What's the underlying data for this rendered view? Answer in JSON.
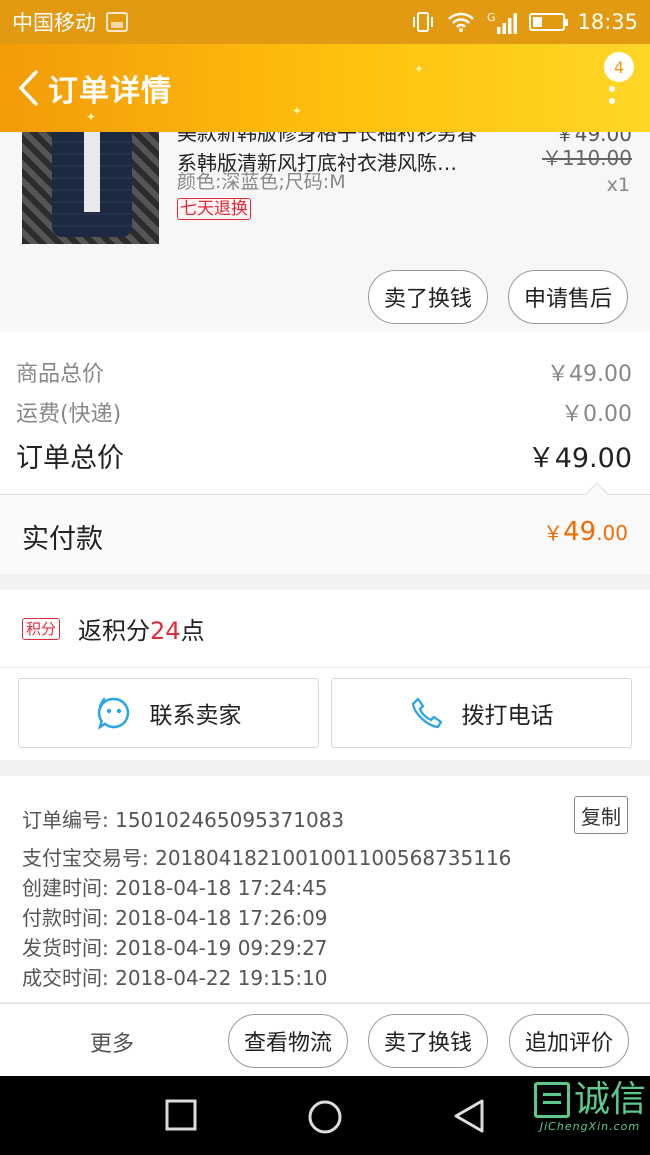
{
  "status_bar": {
    "carrier": "中国移动",
    "network": "G",
    "time": "18:35"
  },
  "header": {
    "title": "订单详情",
    "badge_count": "4"
  },
  "product": {
    "title_line1": "美款新韩版修身格子长袖衬衫男春",
    "title_line2": "系韩版清新风打底衬衣港风陈…",
    "sku": "颜色:深蓝色;尺码:M",
    "tag": "七天退换",
    "price": "￥49.00",
    "original_price": "￥110.00",
    "quantity": "x1",
    "buttons": {
      "sell": "卖了换钱",
      "after_sale": "申请售后"
    }
  },
  "summary": {
    "goods_label": "商品总价",
    "goods_value": "￥49.00",
    "shipping_label": "运费(快递)",
    "shipping_value": "￥0.00",
    "order_total_label": "订单总价",
    "order_total_value": "￥49.00",
    "paid_label": "实付款",
    "paid_currency": "￥",
    "paid_int": "49",
    "paid_dec": ".00"
  },
  "points": {
    "tag": "积分",
    "prefix": "返积分",
    "value": "24",
    "suffix": "点"
  },
  "contact": {
    "seller": "联系卖家",
    "phone": "拨打电话"
  },
  "order_info": {
    "copy": "复制",
    "lines": [
      {
        "label": "订单编号:",
        "value": "150102465095371083"
      },
      {
        "label": "支付宝交易号:",
        "value": "2018041821001001100568735116"
      },
      {
        "label": "创建时间:",
        "value": "2018-04-18 17:24:45"
      },
      {
        "label": "付款时间:",
        "value": "2018-04-18 17:26:09"
      },
      {
        "label": "发货时间:",
        "value": "2018-04-19 09:29:27"
      },
      {
        "label": "成交时间:",
        "value": "2018-04-22 19:15:10"
      }
    ]
  },
  "actions": {
    "more": "更多",
    "logistics": "查看物流",
    "sell": "卖了换钱",
    "review": "追加评价"
  },
  "watermark": {
    "text": "诚信",
    "sub": "JiChengXin.com"
  },
  "colors": {
    "header_start": "#f39b08",
    "header_end": "#ffd626",
    "accent_red": "#e02b3a",
    "paid_orange": "#f26a00",
    "icon_blue": "#2aa6e8"
  }
}
